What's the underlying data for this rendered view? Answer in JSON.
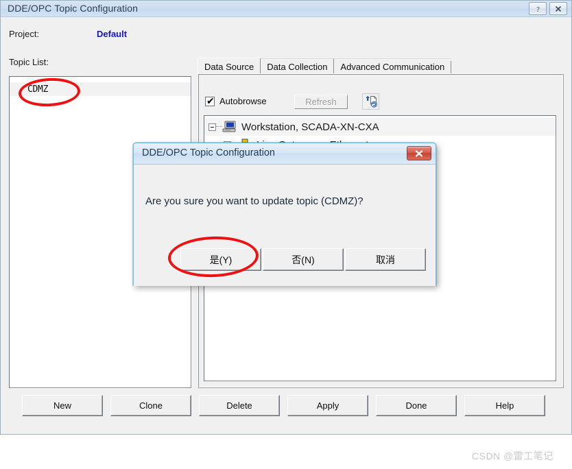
{
  "window": {
    "title": "DDE/OPC Topic Configuration",
    "caption_buttons": [
      {
        "name": "help-button",
        "glyph": "?"
      },
      {
        "name": "close-button",
        "glyph": "X"
      }
    ]
  },
  "project": {
    "label": "Project:",
    "value": "Default"
  },
  "topic_list": {
    "label": "Topic List:",
    "items": [
      {
        "name": "CDMZ",
        "selected": true
      }
    ]
  },
  "tabs": [
    {
      "label": "Data Source",
      "active": true
    },
    {
      "label": "Data Collection",
      "active": false
    },
    {
      "label": "Advanced Communication",
      "active": false
    }
  ],
  "data_source": {
    "autobrowse": {
      "label": "Autobrowse",
      "checked": true,
      "check_glyph": "✔"
    },
    "refresh_button": {
      "label": "Refresh",
      "enabled": false
    },
    "browse_icon": "browse-refresh-icon",
    "tree": [
      {
        "label": "Workstation, SCADA-XN-CXA",
        "icon": "computer-icon",
        "expander": "minus",
        "expanded": true,
        "depth": 0,
        "selected": true
      },
      {
        "label": "Linx Gateways, Ethernet",
        "icon": "network-icon",
        "expander": "plus",
        "expanded": false,
        "depth": 1,
        "selected": false
      }
    ]
  },
  "buttons": [
    {
      "label": "New"
    },
    {
      "label": "Clone"
    },
    {
      "label": "Delete"
    },
    {
      "label": "Apply"
    },
    {
      "label": "Done"
    },
    {
      "label": "Help"
    }
  ],
  "modal": {
    "title": "DDE/OPC Topic Configuration",
    "close_icon": "close-icon",
    "message": "Are you sure you want to update topic (CDMZ)?",
    "buttons": [
      {
        "label": "是(Y)",
        "name": "yes-button",
        "default": true
      },
      {
        "label": "否(N)",
        "name": "no-button",
        "default": false
      },
      {
        "label": "取消",
        "name": "cancel-button",
        "default": false
      }
    ]
  },
  "annotations": [
    {
      "name": "annotation-topic-cdmz",
      "color": "#ee1111",
      "shape": "ellipse"
    },
    {
      "name": "annotation-yes-button",
      "color": "#ee1111",
      "shape": "ellipse"
    }
  ],
  "watermark": {
    "text": "CSDN @雷工笔记"
  }
}
